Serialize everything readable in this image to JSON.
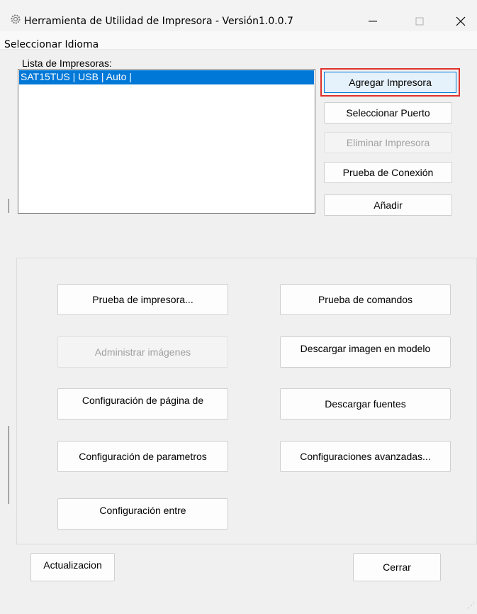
{
  "window": {
    "title": "Herramienta de Utilidad de Impresora - Versión1.0.0.7",
    "icon": "gear-icon",
    "controls": {
      "minimize": "—",
      "maximize": "□",
      "close": "✕"
    }
  },
  "menu": {
    "language": "Seleccionar Idioma"
  },
  "printers": {
    "label": "Lista de Impresoras:",
    "items": [
      "SAT15TUS | USB | Auto |"
    ]
  },
  "side_buttons": {
    "add": "Agregar Impresora",
    "select_port": "Seleccionar Puerto",
    "delete": "Eliminar Impresora",
    "connection_test": "Prueba de Conexión",
    "add_more": "Añadir"
  },
  "main_buttons": {
    "test_print": "Prueba de impresora...",
    "test_commands": "Prueba de comandos",
    "manage_images": "Administrar imágenes",
    "download_image": "Descargar imagen en modelo",
    "page_config": "Configuración de página de",
    "download_fonts": "Descargar fuentes",
    "param_config": "Configuración de parametros",
    "advanced_config": "Configuraciones avanzadas...",
    "config_between": "Configuración entre"
  },
  "footer": {
    "update": "Actualizacion",
    "close": "Cerrar"
  },
  "colors": {
    "selection": "#0078d7",
    "highlight_border": "#e0312c",
    "background": "#f0f0f0"
  }
}
